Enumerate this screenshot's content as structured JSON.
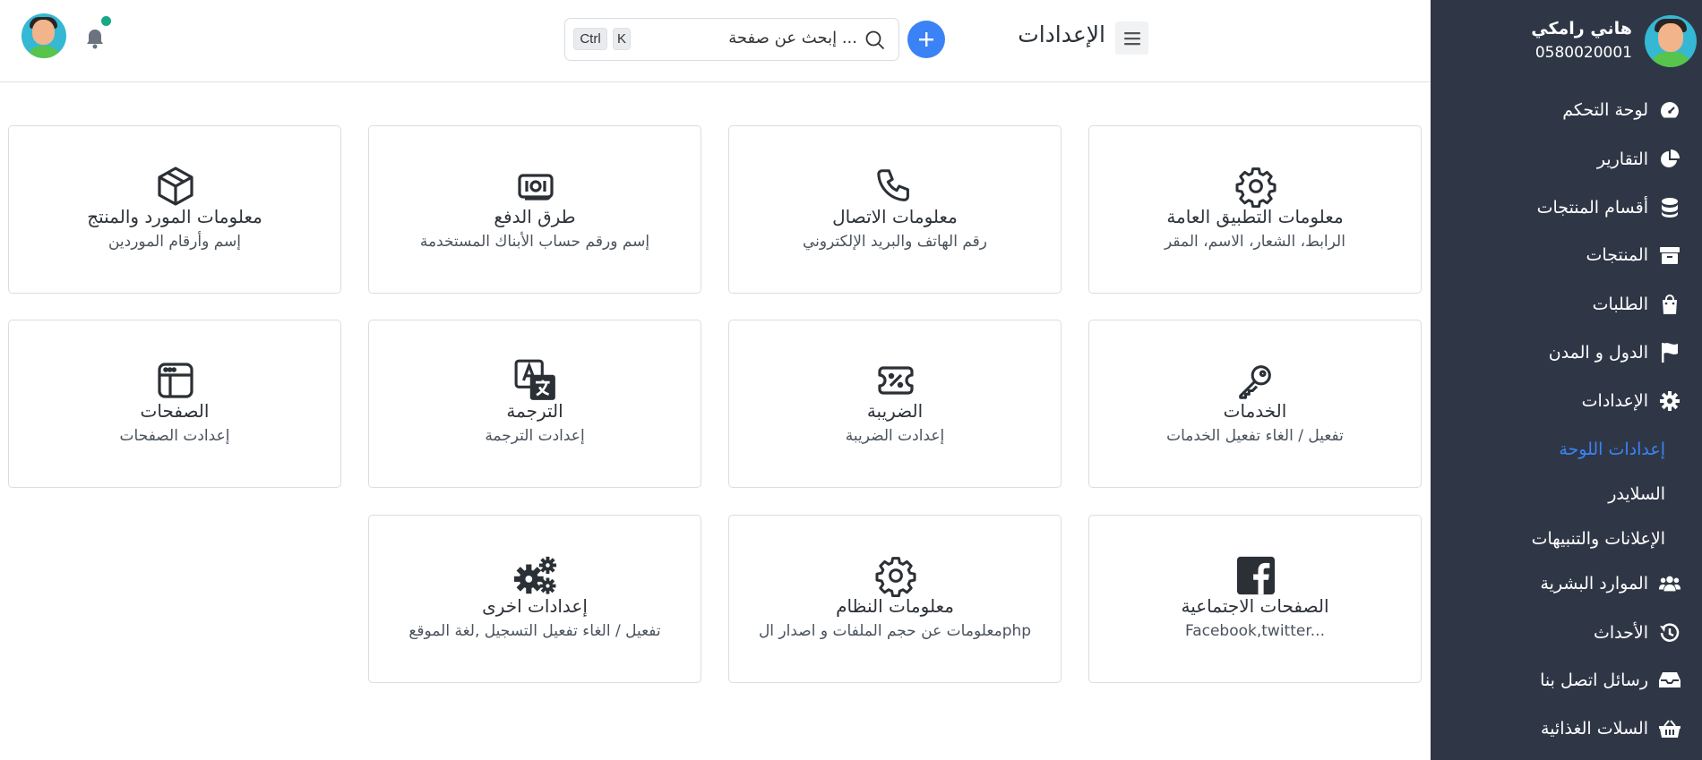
{
  "profile": {
    "name": "هاني رامكي",
    "phone": "0580020001"
  },
  "sidebar": {
    "items": [
      {
        "label": "لوحة التحكم",
        "icon": "speedometer-icon"
      },
      {
        "label": "التقارير",
        "icon": "pie-chart-icon"
      },
      {
        "label": "أقسام المنتجات",
        "icon": "database-icon"
      },
      {
        "label": "المنتجات",
        "icon": "box-icon"
      },
      {
        "label": "الطلبات",
        "icon": "shopping-bag-icon"
      },
      {
        "label": "الدول و المدن",
        "icon": "flag-icon"
      },
      {
        "label": "الإعدادات",
        "icon": "gear-icon"
      },
      {
        "label": "الموارد البشرية",
        "icon": "users-icon"
      },
      {
        "label": "الأحداث",
        "icon": "history-icon"
      },
      {
        "label": "رسائل اتصل بنا",
        "icon": "inbox-icon"
      },
      {
        "label": "السلات الغذائية",
        "icon": "basket-icon"
      }
    ],
    "subitems": [
      {
        "label": "إعدادات اللوحة",
        "active": true
      },
      {
        "label": "السلايدر",
        "active": false
      },
      {
        "label": "الإعلانات والتنبيهات",
        "active": false
      }
    ]
  },
  "header": {
    "title": "الإعدادات",
    "search": {
      "placeholder": "إبحث عن صفحة ...",
      "shortcut_ctrl": "Ctrl",
      "shortcut_key": "K"
    }
  },
  "colors": {
    "accent": "#3b82f6",
    "sidebar_bg": "#2f3746",
    "notification": "#19a886"
  },
  "cards": [
    {
      "title": "معلومات التطبيق العامة",
      "description": "الرابط، الشعار، الاسم، المقر",
      "icon": "gear-icon"
    },
    {
      "title": "معلومات الاتصال",
      "description": "رقم الهاتف والبريد الإلكتروني",
      "icon": "phone-icon"
    },
    {
      "title": "طرق الدفع",
      "description": "إسم ورقم حساب الأبناك المستخدمة",
      "icon": "cash-icon"
    },
    {
      "title": "معلومات المورد والمنتج",
      "description": "إسم وأرقام الموردين",
      "icon": "package-icon"
    },
    {
      "title": "الخدمات",
      "description": "تفعيل / الغاء تفعيل الخدمات",
      "icon": "key-icon"
    },
    {
      "title": "الضريبة",
      "description": "إعدادت الضريبة",
      "icon": "tax-ticket-icon"
    },
    {
      "title": "الترجمة",
      "description": "إعدادت الترجمة",
      "icon": "translate-icon"
    },
    {
      "title": "الصفحات",
      "description": "إعدادت الصفحات",
      "icon": "browser-icon"
    },
    {
      "title": "الصفحات الاجتماعية",
      "description": "Facebook,twitter...",
      "icon": "facebook-icon"
    },
    {
      "title": "معلومات النظام",
      "description": "معلومات عن حجم الملفات و اصدار الphp",
      "icon": "gear-icon"
    },
    {
      "title": "إعدادات اخرى",
      "description": "تفعيل / الغاء تفعيل التسجيل ,لغة الموقع",
      "icon": "gears-icon"
    }
  ]
}
